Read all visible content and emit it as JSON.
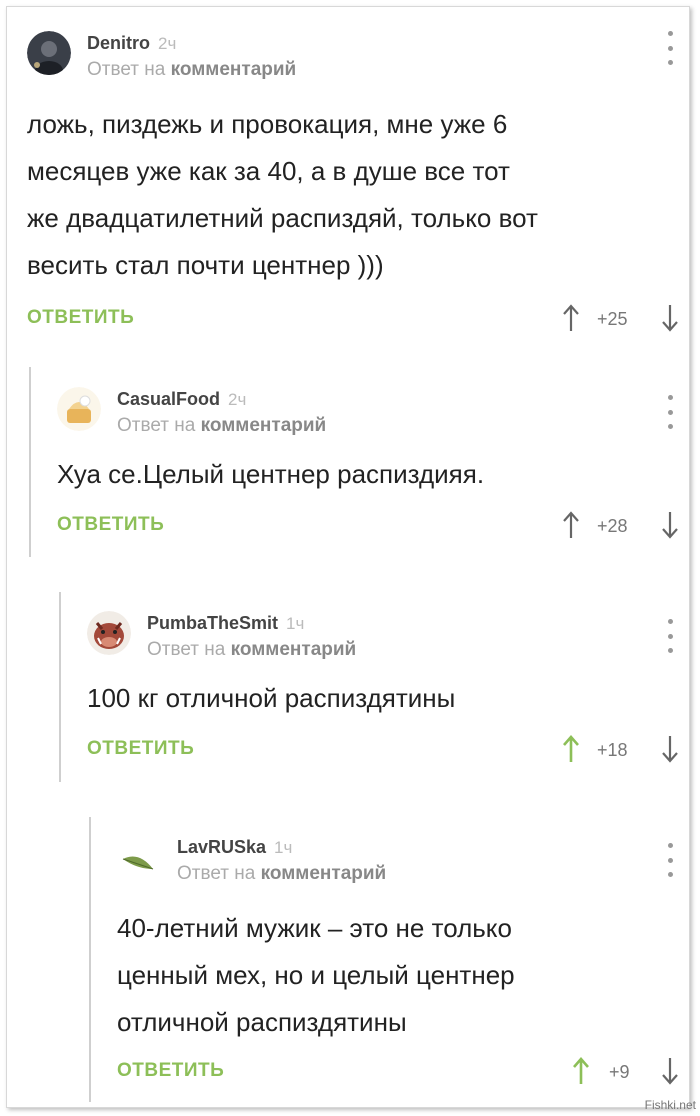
{
  "comments": [
    {
      "username": "Denitro",
      "time": "2ч",
      "reply_prefix": "Ответ на",
      "reply_target": "комментарий",
      "text": [
        "ложь, пиздежь и провокация, мне уже 6",
        "месяцев уже как за 40, а в душе все тот",
        "же двадцатилетний распиздяй, только вот",
        "весить стал почти центнер )))"
      ],
      "reply_label": "ОТВЕТИТЬ",
      "score": "+25",
      "upvoted": false
    },
    {
      "username": "CasualFood",
      "time": "2ч",
      "reply_prefix": "Ответ на",
      "reply_target": "комментарий",
      "text": [
        "Хуа се.Целый центнер распиздияя."
      ],
      "reply_label": "ОТВЕТИТЬ",
      "score": "+28",
      "upvoted": false
    },
    {
      "username": "PumbaTheSmit",
      "time": "1ч",
      "reply_prefix": "Ответ на",
      "reply_target": "комментарий",
      "text": [
        "100 кг отличной распиздятины"
      ],
      "reply_label": "ОТВЕТИТЬ",
      "score": "+18",
      "upvoted": true
    },
    {
      "username": "LavRUSka",
      "time": "1ч",
      "reply_prefix": "Ответ на",
      "reply_target": "комментарий",
      "text": [
        "40-летний мужик – это не только",
        "ценный мех, но и целый центнер",
        "отличной распиздятины"
      ],
      "reply_label": "ОТВЕТИТЬ",
      "score": "+9",
      "upvoted": true
    }
  ],
  "colors": {
    "accent_green": "#8dbf58",
    "arrow_gray": "#666666",
    "thread_line": "#cfcfcf"
  },
  "icons": {
    "avatar_denitro": "dark-photo-avatar",
    "avatar_casualfood": "food-avatar",
    "avatar_pumba": "boar-avatar",
    "avatar_lavruska": "bay-leaf-avatar",
    "menu": "vertical-dots-icon",
    "upvote": "arrow-up-icon",
    "downvote": "arrow-down-icon"
  },
  "watermark": "Fishki.net"
}
